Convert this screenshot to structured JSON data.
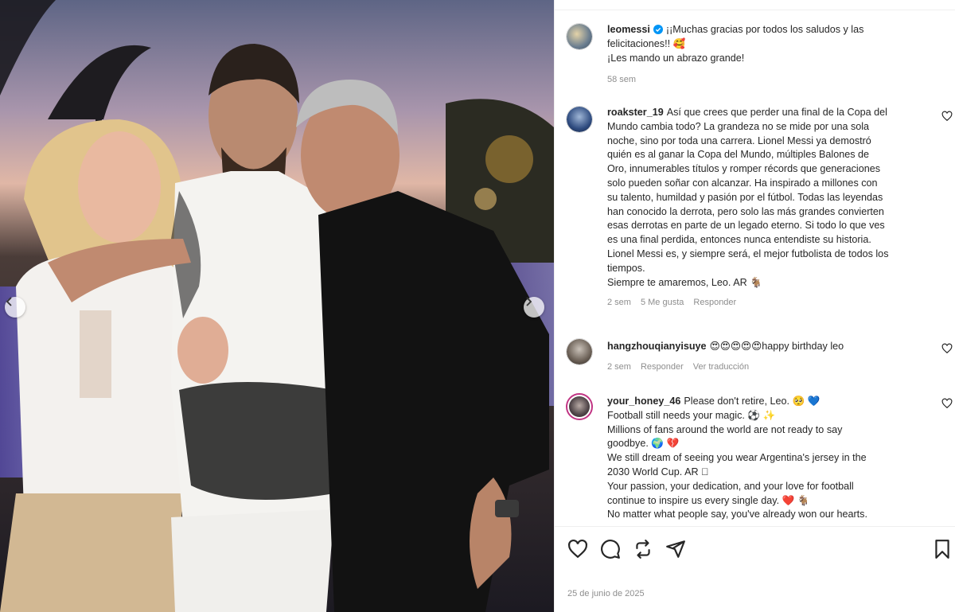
{
  "photo": {
    "prev_icon": "chevron-left-icon",
    "next_icon": "chevron-right-icon"
  },
  "comments": [
    {
      "username": "leomessi",
      "verified": true,
      "lines": [
        "¡¡Muchas gracias por todos los saludos y las",
        "felicitaciones!! 🥰",
        "¡Les mando un abrazo grande!"
      ],
      "meta": [
        "58 sem"
      ]
    },
    {
      "username": "roakster_19",
      "lines": [
        "Así que crees que perder una final de la Copa del",
        "Mundo cambia todo? La grandeza no se mide por una sola",
        "noche, sino por toda una carrera. Lionel Messi ya demostró",
        "quién es al ganar la Copa del Mundo, múltiples Balones de",
        "Oro, innumerables títulos y romper récords que generaciones",
        "solo pueden soñar con alcanzar. Ha inspirado a millones con",
        "su talento, humildad y pasión por el fútbol. Todas las leyendas",
        "han conocido la derrota, pero solo las más grandes convierten",
        "esas derrotas en parte de un legado eterno. Si todo lo que ves",
        "es una final perdida, entonces nunca entendiste su historia.",
        "Lionel Messi es, y siempre será, el mejor futbolista de todos los",
        "tiempos.",
        "Siempre te amaremos, Leo. AR 🐐"
      ],
      "meta": [
        "2 sem",
        "5 Me gusta",
        "Responder"
      ]
    },
    {
      "username": "hangzhouqianyisuye",
      "lines": [
        "😍😍😍😍😍happy birthday leo"
      ],
      "meta": [
        "2 sem",
        "Responder",
        "Ver traducción"
      ]
    },
    {
      "username": "your_honey_46",
      "lines": [
        "Please don't retire, Leo. 🥺 💙",
        "Football still needs your magic. ⚽ ✨",
        "Millions of fans around the world are not ready to say",
        "goodbye. 🌍 💔",
        "We still dream of seeing you wear Argentina's jersey in the",
        "2030 World Cup. AR 🏻",
        "Your passion, your dedication, and your love for football",
        "continue to inspire us every single day. ❤️ 🐐",
        "No matter what people say, you've already won our hearts."
      ],
      "meta": []
    }
  ],
  "actions": {
    "like_icon": "heart-icon",
    "comment_icon": "comment-icon",
    "repost_icon": "repost-icon",
    "share_icon": "send-icon",
    "save_icon": "bookmark-icon"
  },
  "post_date": "25 de junio de 2025",
  "colors": {
    "verified": "#0095f6",
    "meta_text": "#8e8e8e",
    "divider": "#efefef",
    "avatar_ring": "#c13584"
  }
}
